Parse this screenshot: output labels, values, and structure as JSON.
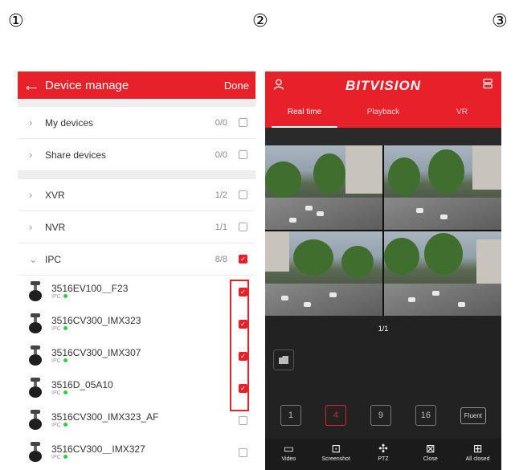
{
  "steps": [
    "①",
    "②",
    "③"
  ],
  "device_manage": {
    "title": "Device manage",
    "done_label": "Done",
    "groups": [
      {
        "label": "My devices",
        "count": "0/0",
        "checked": false
      },
      {
        "label": "Share devices",
        "count": "0/0",
        "checked": false
      }
    ],
    "types": [
      {
        "label": "XVR",
        "count": "1/2",
        "checked": false,
        "expanded": false
      },
      {
        "label": "NVR",
        "count": "1/1",
        "checked": false,
        "expanded": false
      },
      {
        "label": "IPC",
        "count": "8/8",
        "checked": true,
        "expanded": true
      }
    ],
    "devices": [
      {
        "name": "3516EV100＿F23",
        "type": "IPC",
        "checked": true
      },
      {
        "name": "3516CV300_IMX323",
        "type": "IPC",
        "checked": true
      },
      {
        "name": "3516CV300_IMX307",
        "type": "IPC",
        "checked": true
      },
      {
        "name": "3516D_05A10",
        "type": "IPC",
        "checked": true
      },
      {
        "name": "3516CV300_IMX323_AF",
        "type": "IPC",
        "checked": false
      },
      {
        "name": "3516CV300＿IMX327",
        "type": "IPC",
        "checked": false
      }
    ]
  },
  "bitvision": {
    "brand": "BITVISION",
    "tabs": [
      "Real time",
      "Playback",
      "VR"
    ],
    "active_tab": "Real time",
    "page_indicator": "1/1",
    "quality_label": "Fluent",
    "layout_options": [
      "1",
      "4",
      "9",
      "16"
    ],
    "actions": [
      {
        "label": "Video",
        "icon": "video-icon"
      },
      {
        "label": "Screenshot",
        "icon": "screenshot-icon"
      },
      {
        "label": "PTZ",
        "icon": "ptz-icon"
      },
      {
        "label": "Close",
        "icon": "close-icon"
      },
      {
        "label": "All closed",
        "icon": "all-closed-icon"
      }
    ]
  },
  "colors": {
    "accent": "#e8202a",
    "dark": "#222222"
  }
}
